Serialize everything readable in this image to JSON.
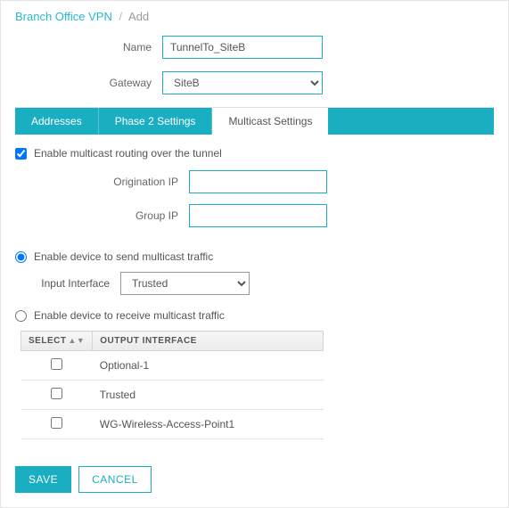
{
  "breadcrumb": {
    "parent": "Branch Office VPN",
    "current": "Add"
  },
  "form": {
    "name_label": "Name",
    "name_value": "TunnelTo_SiteB",
    "gateway_label": "Gateway",
    "gateway_value": "SiteB"
  },
  "tabs": {
    "addresses": "Addresses",
    "phase2": "Phase 2 Settings",
    "multicast": "Multicast Settings"
  },
  "multicast": {
    "enable_label": "Enable multicast routing over the tunnel",
    "enable_checked": true,
    "origination_label": "Origination IP",
    "origination_value": "",
    "group_label": "Group IP",
    "group_value": "",
    "send_label": "Enable device to send multicast traffic",
    "send_selected": true,
    "input_iface_label": "Input Interface",
    "input_iface_value": "Trusted",
    "receive_label": "Enable device to receive multicast traffic",
    "receive_selected": false,
    "table": {
      "col_select": "SELECT",
      "col_output": "OUTPUT INTERFACE",
      "rows": [
        {
          "selected": false,
          "name": "Optional-1"
        },
        {
          "selected": false,
          "name": "Trusted"
        },
        {
          "selected": false,
          "name": "WG-Wireless-Access-Point1"
        }
      ]
    }
  },
  "actions": {
    "save": "SAVE",
    "cancel": "CANCEL"
  }
}
